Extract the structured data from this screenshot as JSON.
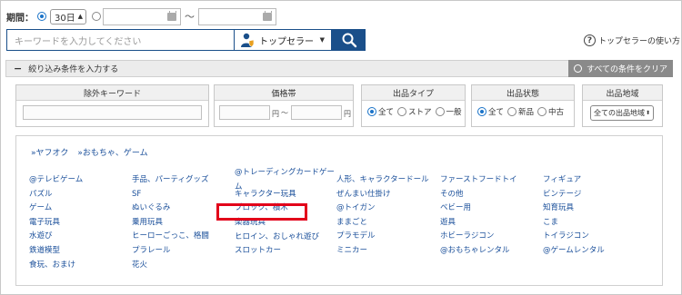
{
  "period": {
    "label": "期間：",
    "days_value": "30日",
    "tilde": "〜"
  },
  "search": {
    "placeholder": "キーワードを入力してください",
    "seller_label": "トップセラー",
    "help_label": "トップセラーの使い方"
  },
  "filters": {
    "header_label": "絞り込み条件を入力する",
    "clear_label": "すべての条件をクリア",
    "exclude": {
      "title": "除外キーワード"
    },
    "price": {
      "title": "価格帯",
      "unit": "円",
      "tilde": "〜"
    },
    "type": {
      "title": "出品タイプ",
      "options": [
        "全て",
        "ストア",
        "一般"
      ]
    },
    "condition": {
      "title": "出品状態",
      "options": [
        "全て",
        "新品",
        "中古"
      ]
    },
    "region": {
      "title": "出品地域",
      "value": "全ての出品地域"
    }
  },
  "categories": {
    "breadcrumb": [
      "»ヤフオク",
      "»おもちゃ、ゲーム"
    ],
    "columns": [
      [
        "@テレビゲーム",
        "パズル",
        "ゲーム",
        "電子玩具",
        "水遊び",
        "鉄道模型",
        "食玩、おまけ"
      ],
      [
        "手品、パーティグッズ",
        "SF",
        "ぬいぐるみ",
        "乗用玩具",
        "ヒーローごっこ、格闘",
        "プラレール",
        "花火"
      ],
      [
        "@トレーディングカードゲーム",
        "キャラクター玩具",
        "ブロック、積木",
        "楽器玩具",
        "ヒロイン、おしゃれ遊び",
        "スロットカー"
      ],
      [
        "人形、キャラクタードール",
        "ぜんまい仕掛け",
        "@トイガン",
        "ままごと",
        "プラモデル",
        "ミニカー"
      ],
      [
        "ファーストフードトイ",
        "その他",
        "ベビー用",
        "遊具",
        "ホビーラジコン",
        "@おもちゃレンタル"
      ],
      [
        "フィギュア",
        "ビンテージ",
        "知育玩具",
        "こま",
        "トイラジコン",
        "@ゲームレンタル"
      ]
    ],
    "highlighted": "ブロック、積木"
  },
  "colors": {
    "accent": "#1a4f8a",
    "link": "#1a4f9a",
    "highlight_border": "#e2001a",
    "clear_button": "#8a8a8a"
  },
  "icons": {
    "seller": "person-with-shield-icon",
    "search": "magnifier-icon",
    "help": "question-circle-icon",
    "calendar": "calendar-icon"
  }
}
